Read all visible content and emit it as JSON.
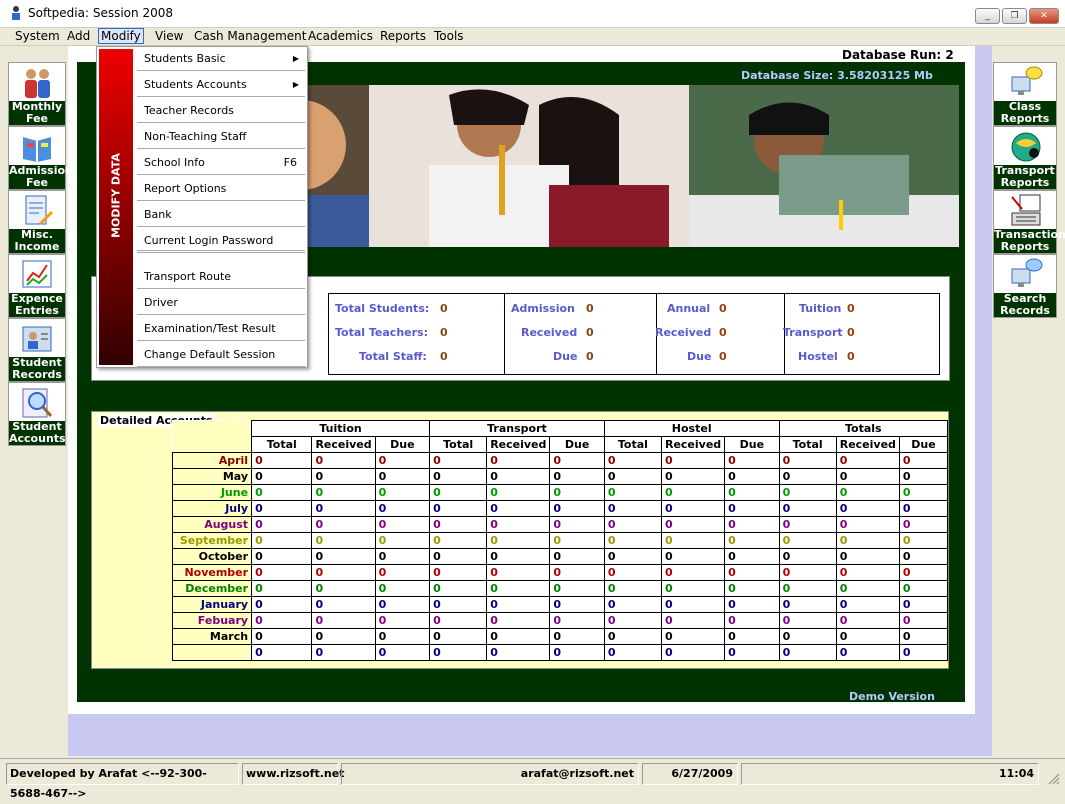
{
  "window": {
    "title": "Softpedia:  Session 2008"
  },
  "menu": [
    "System",
    "Add",
    "Modify",
    "View",
    "Cash Management",
    "Academics",
    "Reports",
    "Tools"
  ],
  "left_buttons": [
    {
      "label": "Monthly Fee",
      "icon": "people-icon"
    },
    {
      "label": "Admission Fee",
      "icon": "book-icon"
    },
    {
      "label": "Misc. Income",
      "icon": "document-icon"
    },
    {
      "label": "Expence Entries",
      "icon": "chart-icon"
    },
    {
      "label": "Student Records",
      "icon": "student-icon"
    },
    {
      "label": "Student Accounts",
      "icon": "magnifier-icon"
    }
  ],
  "right_buttons": [
    {
      "label": "Class Reports",
      "icon": "monitor-bubble-icon"
    },
    {
      "label": "Transport Reports",
      "icon": "globe-icon"
    },
    {
      "label": "Transaction Reports",
      "icon": "keyboard-icon"
    },
    {
      "label": "Search Records",
      "icon": "monitor-search-icon"
    }
  ],
  "header": {
    "db_run": "Database Run: 2",
    "db_size": "Database Size: 3.58203125  Mb"
  },
  "dropdown": {
    "side_label": "MODIFY DATA",
    "items": [
      {
        "label": "Students Basic",
        "arrow": "▶"
      },
      {
        "label": "Students Accounts",
        "arrow": "▶"
      },
      {
        "label": "Teacher Records"
      },
      {
        "label": "Non-Teaching Staff"
      },
      {
        "label": "School Info",
        "shortcut": "F6"
      },
      {
        "label": "Report Options"
      },
      {
        "label": "Bank"
      },
      {
        "label": "Current Login Password"
      },
      {
        "label": "Transport Route"
      },
      {
        "label": "Driver"
      },
      {
        "label": "Examination/Test Result"
      },
      {
        "label": "Change Default Session"
      }
    ]
  },
  "stats": {
    "total_students": {
      "label": "Total Students:",
      "value": "0"
    },
    "total_teachers": {
      "label": "Total Teachers:",
      "value": "0"
    },
    "total_staff": {
      "label": "Total Staff:",
      "value": "0"
    },
    "admission": {
      "label": "Admission",
      "value": "0"
    },
    "adm_received": {
      "label": "Received",
      "value": "0"
    },
    "adm_due": {
      "label": "Due",
      "value": "0"
    },
    "annual": {
      "label": "Annual",
      "value": "0"
    },
    "ann_received": {
      "label": "Received",
      "value": "0"
    },
    "ann_due": {
      "label": "Due",
      "value": "0"
    },
    "tuition": {
      "label": "Tuition",
      "value": "0"
    },
    "transport": {
      "label": "Transport",
      "value": "0"
    },
    "hostel": {
      "label": "Hostel",
      "value": "0"
    }
  },
  "detailed": {
    "title": "Detailed Accounts",
    "groups": [
      "Tuition",
      "Transport",
      "Hostel",
      "Totals"
    ],
    "subheaders": [
      "Total",
      "Received",
      "Due"
    ],
    "months": [
      {
        "name": "April",
        "color": "#8b0000"
      },
      {
        "name": "May",
        "color": "#000000"
      },
      {
        "name": "June",
        "color": "#009900"
      },
      {
        "name": "July",
        "color": "#000080"
      },
      {
        "name": "August",
        "color": "#800080"
      },
      {
        "name": "September",
        "color": "#999900"
      },
      {
        "name": "October",
        "color": "#000000"
      },
      {
        "name": "November",
        "color": "#b00000"
      },
      {
        "name": "December",
        "color": "#008000"
      },
      {
        "name": "January",
        "color": "#000080"
      },
      {
        "name": "Febuary",
        "color": "#800080"
      },
      {
        "name": "March",
        "color": "#000000"
      },
      {
        "name": "",
        "color": "#000080"
      }
    ],
    "cell_value": "0"
  },
  "demo": "Demo Version",
  "status": {
    "developer": "Developed by Arafat <--92-300-5688-467-->",
    "website": "www.rizsoft.net",
    "email": "arafat@rizsoft.net",
    "date": "6/27/2009",
    "time": "11:04"
  }
}
